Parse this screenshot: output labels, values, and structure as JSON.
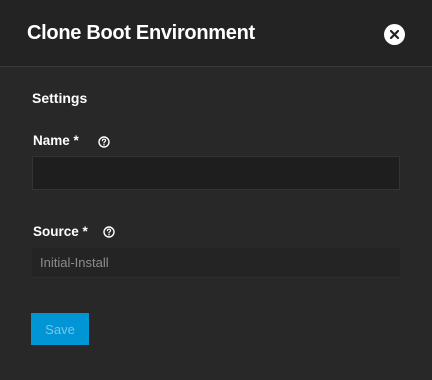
{
  "dialog": {
    "title": "Clone Boot Environment",
    "close_icon": "close-circle-icon"
  },
  "form": {
    "section_title": "Settings",
    "name": {
      "label": "Name *",
      "value": "",
      "placeholder": "",
      "help_icon": "help-circle-icon"
    },
    "source": {
      "label": "Source *",
      "value": "Initial-Install",
      "help_icon": "help-circle-icon"
    },
    "save_label": "Save"
  },
  "colors": {
    "background": "#282828",
    "header": "#232323",
    "accent": "#0095d5",
    "text": "#ffffff",
    "muted_text": "#8d8d8d"
  }
}
